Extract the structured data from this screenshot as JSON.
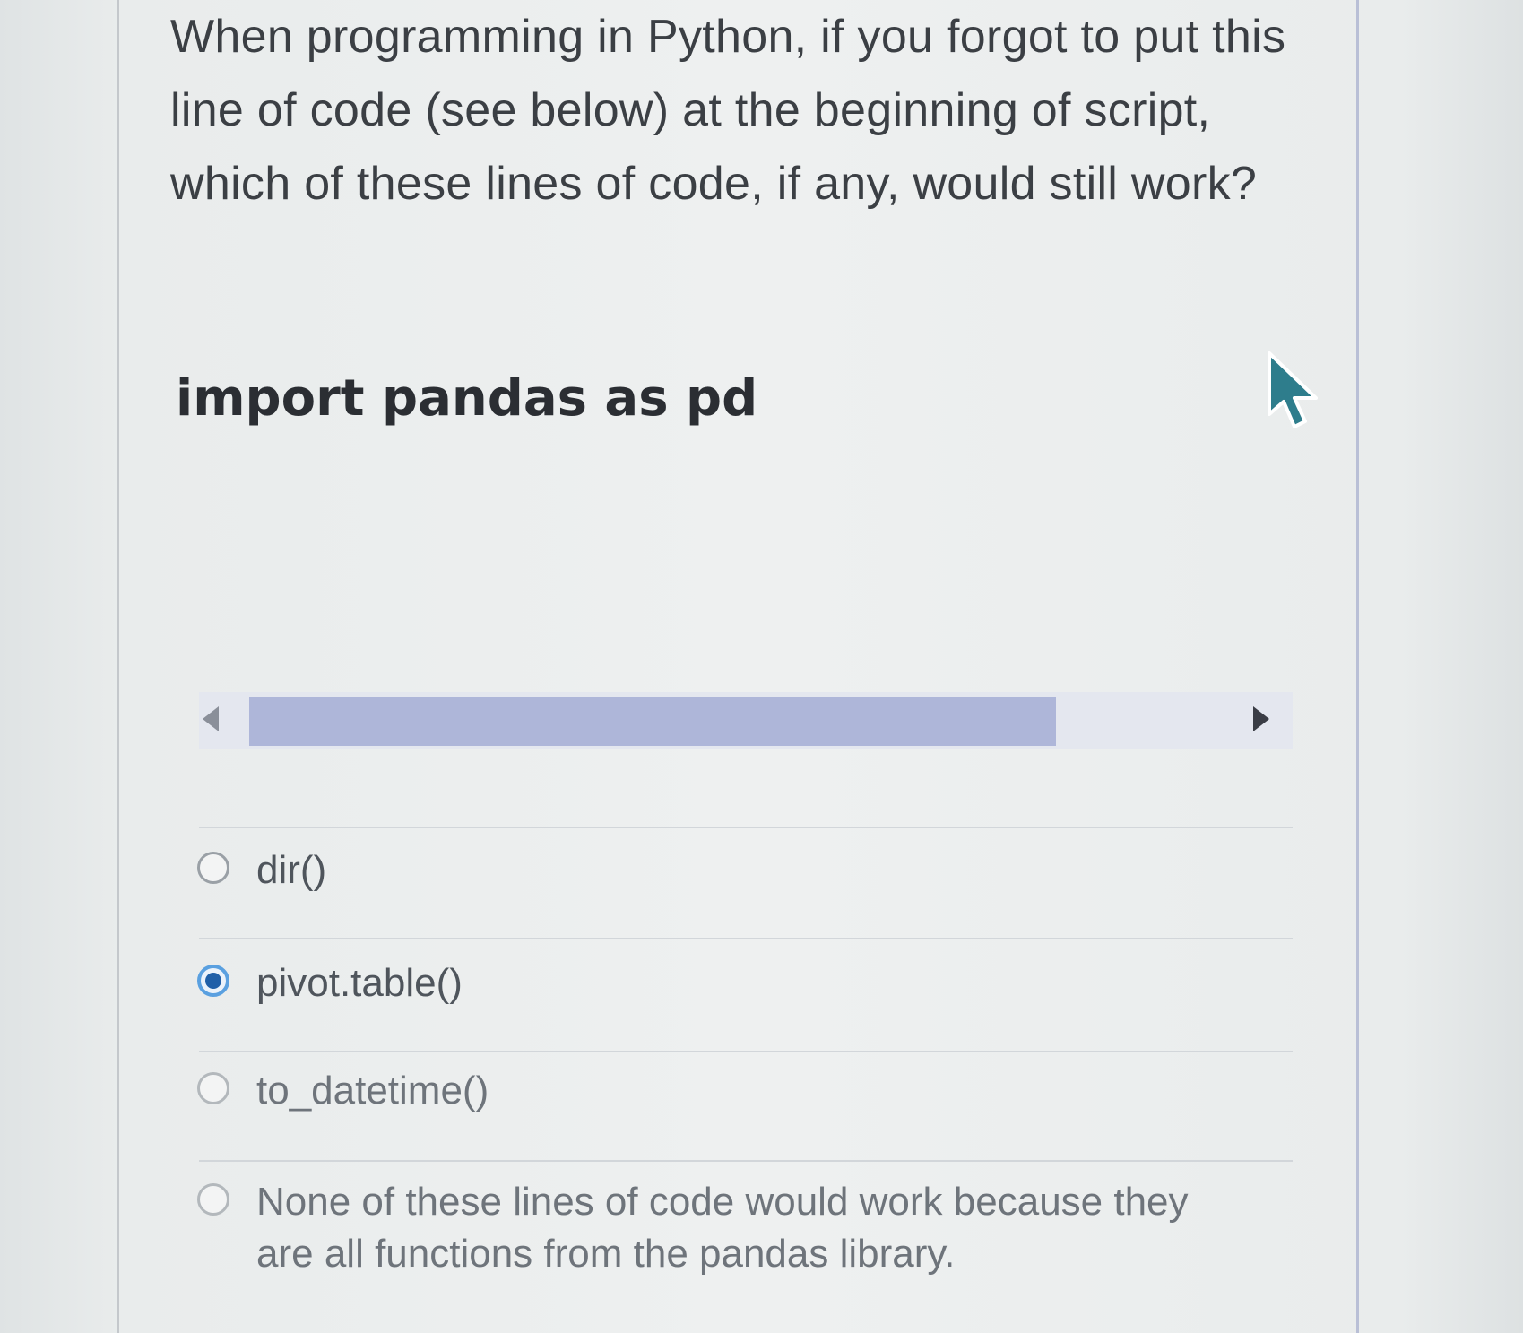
{
  "question": {
    "lines": [
      "When programming in Python, if you forgot to put this",
      "line of code (see below) at the beginning of script,",
      "which of these lines of code, if any, would still work?"
    ]
  },
  "code": "import pandas as pd",
  "options": [
    {
      "label": "dir()",
      "selected": false
    },
    {
      "label": "pivot.table()",
      "selected": true
    },
    {
      "label": "to_datetime()",
      "selected": false
    },
    {
      "label_lines": [
        "None of these lines of code would work because they",
        "are all functions from the pandas library."
      ],
      "selected": false
    }
  ],
  "colors": {
    "selected_radio": "#1f5fa8",
    "scroll_thumb": "#aeb6d9"
  }
}
